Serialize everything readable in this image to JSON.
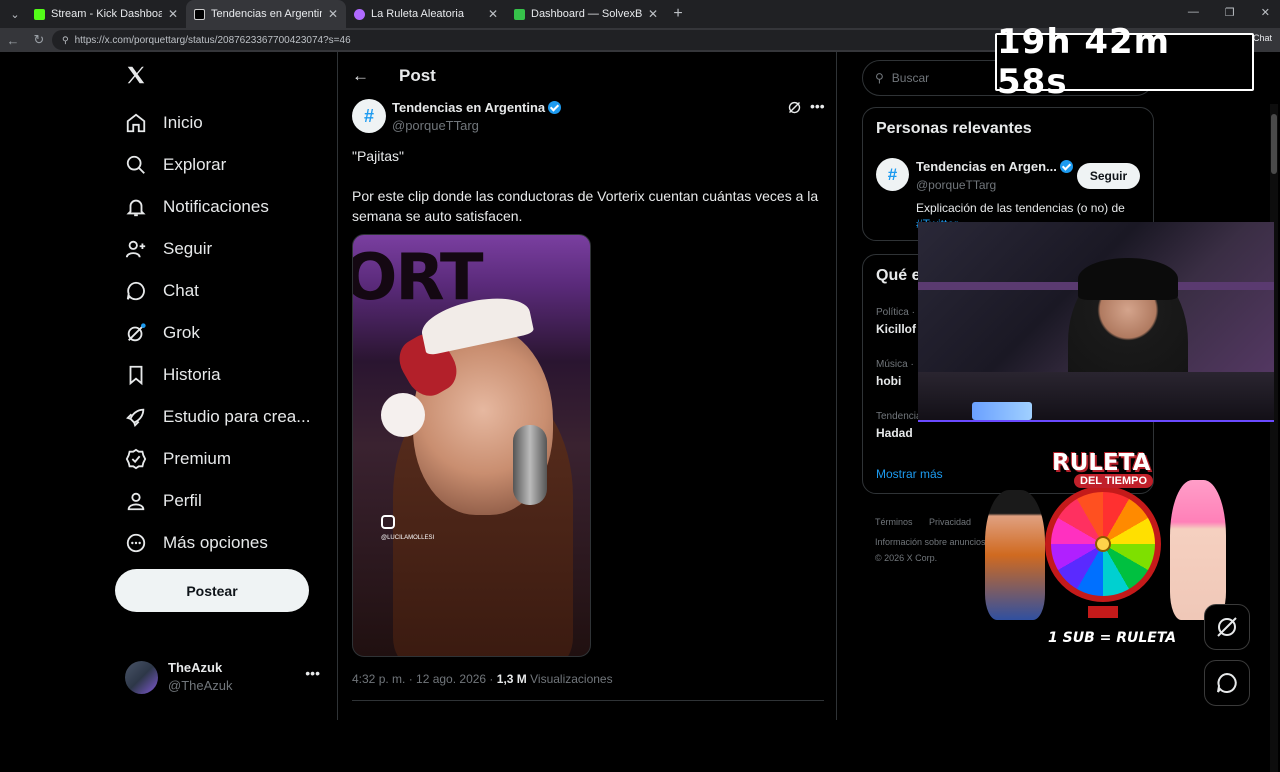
{
  "browser": {
    "tabs": [
      {
        "title": "Stream - Kick Dashboard",
        "color": "#53fc18"
      },
      {
        "title": "Tendencias en Argentina en X",
        "color": "#e7e9ea"
      },
      {
        "title": "La Ruleta Aleatoria",
        "color": "#b06aff"
      },
      {
        "title": "Dashboard — SolvexBot",
        "color": "#36c24a"
      }
    ],
    "url": "https://x.com/porquettarg/status/2087623367700423074?s=46",
    "chat_label": "Chat"
  },
  "nav": {
    "items": [
      {
        "label": "Inicio",
        "icon": "home-icon"
      },
      {
        "label": "Explorar",
        "icon": "search-icon"
      },
      {
        "label": "Notificaciones",
        "icon": "bell-icon"
      },
      {
        "label": "Seguir",
        "icon": "follow-icon"
      },
      {
        "label": "Chat",
        "icon": "chat-icon"
      },
      {
        "label": "Grok",
        "icon": "grok-icon"
      },
      {
        "label": "Historia",
        "icon": "bookmark-icon"
      },
      {
        "label": "Estudio para crea...",
        "icon": "rocket-icon"
      },
      {
        "label": "Premium",
        "icon": "verified-icon"
      },
      {
        "label": "Perfil",
        "icon": "person-icon"
      },
      {
        "label": "Más opciones",
        "icon": "more-circle-icon"
      }
    ],
    "post_button": "Postear",
    "account": {
      "name": "TheAzuk",
      "handle": "@TheAzuk"
    }
  },
  "post": {
    "heading": "Post",
    "author_name": "Tendencias en Argentina",
    "author_handle": "@porqueTTarg",
    "text_line1": "\"Pajitas\"",
    "text_body": "Por este clip donde las conductoras de Vorterix cuentan cuántas veces a la semana se auto satisfacen.",
    "media_watermark": "@LUCILAMOLLESI",
    "meta_time": "4:32 p. m. · 12 ago. 2026 · ",
    "meta_views": "1,3 M",
    "meta_views_label": " Visualizaciones"
  },
  "sidebar": {
    "search_placeholder": "Buscar",
    "relevant_title": "Personas relevantes",
    "relevant": {
      "name": "Tendencias en Argen...",
      "handle": "@porqueTTarg",
      "follow": "Seguir",
      "bio_prefix": "Explicación de las tendencias (o no) de ",
      "bio_link": "#Twitter"
    },
    "trends_title": "Qué e",
    "trends": [
      {
        "category": "Política ·",
        "name": "Kicillof"
      },
      {
        "category": "Música ·",
        "name": "hobi"
      },
      {
        "category": "Tendencia",
        "name": "Hadad"
      }
    ],
    "show_more": "Mostrar más",
    "footer": {
      "terms": "Términos",
      "privacy": "Privacidad",
      "cookies": "Co",
      "ads": "Información sobre anuncios",
      "more": "Má",
      "copyright": "© 2026 X Corp."
    }
  },
  "overlay": {
    "timer": "19h 42m 58s",
    "roulette_title": "RULETA",
    "roulette_sub": "DEL TIEMPO",
    "roulette_label": "1 SUB = RULETA"
  }
}
